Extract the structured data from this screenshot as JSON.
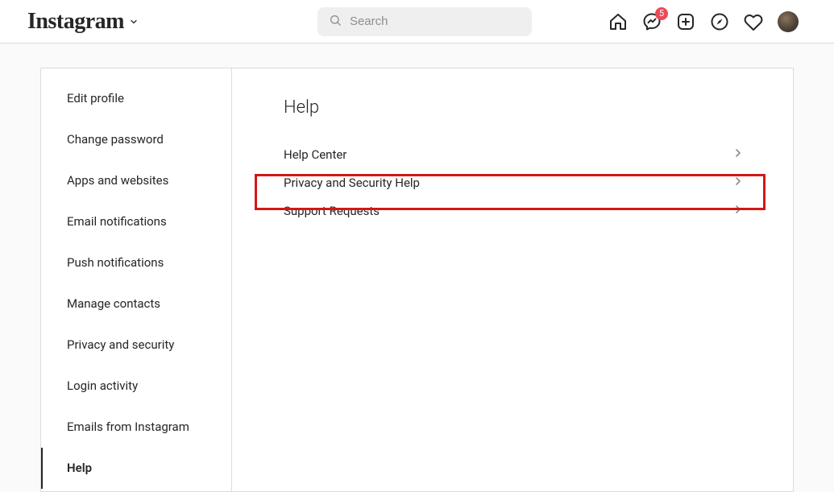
{
  "header": {
    "logo_text": "Instagram",
    "search_placeholder": "Search",
    "badge_count": "5"
  },
  "sidebar": {
    "items": [
      {
        "label": "Edit profile",
        "active": false
      },
      {
        "label": "Change password",
        "active": false
      },
      {
        "label": "Apps and websites",
        "active": false
      },
      {
        "label": "Email notifications",
        "active": false
      },
      {
        "label": "Push notifications",
        "active": false
      },
      {
        "label": "Manage contacts",
        "active": false
      },
      {
        "label": "Privacy and security",
        "active": false
      },
      {
        "label": "Login activity",
        "active": false
      },
      {
        "label": "Emails from Instagram",
        "active": false
      },
      {
        "label": "Help",
        "active": true
      }
    ]
  },
  "content": {
    "title": "Help",
    "help_items": [
      {
        "label": "Help Center"
      },
      {
        "label": "Privacy and Security Help"
      },
      {
        "label": "Support Requests"
      }
    ]
  }
}
